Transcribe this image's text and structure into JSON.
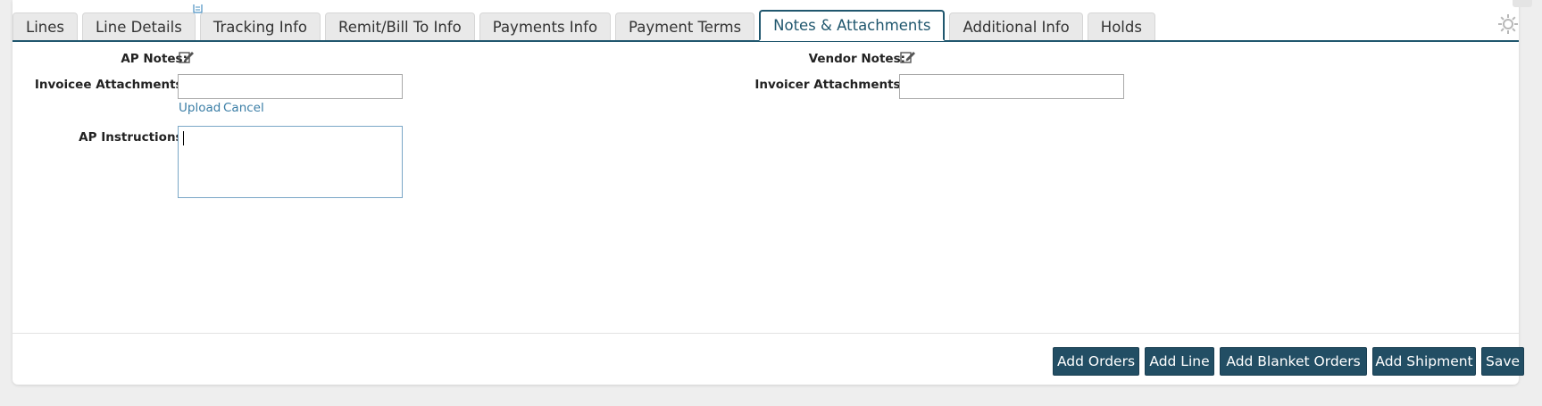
{
  "tabs": [
    {
      "label": "Lines",
      "active": false
    },
    {
      "label": "Line Details",
      "active": false
    },
    {
      "label": "Tracking Info",
      "active": false
    },
    {
      "label": "Remit/Bill To Info",
      "active": false
    },
    {
      "label": "Payments Info",
      "active": false
    },
    {
      "label": "Payment Terms",
      "active": false
    },
    {
      "label": "Notes & Attachments",
      "active": true
    },
    {
      "label": "Additional Info",
      "active": false
    },
    {
      "label": "Holds",
      "active": false
    }
  ],
  "form": {
    "ap_notes_label": "AP Notes:",
    "vendor_notes_label": "Vendor Notes:",
    "invoicee_attachments_label": "Invoicee Attachments:",
    "invoicer_attachments_label": "Invoicer Attachments:",
    "ap_instructions_label": "AP Instructions:",
    "invoicee_attachments_value": "",
    "invoicer_attachments_value": "",
    "ap_instructions_value": "",
    "upload_label": "Upload",
    "cancel_label": "Cancel"
  },
  "footer": {
    "add_orders": "Add Orders",
    "add_line": "Add Line",
    "add_blanket_orders": "Add Blanket Orders",
    "add_shipment": "Add Shipment",
    "save": "Save"
  },
  "icons": {
    "settings": "gear-icon",
    "edit": "edit-icon",
    "document": "document-icon"
  },
  "colors": {
    "accent": "#20576e",
    "button_bg": "#224e64",
    "link": "#3b7ea6"
  }
}
